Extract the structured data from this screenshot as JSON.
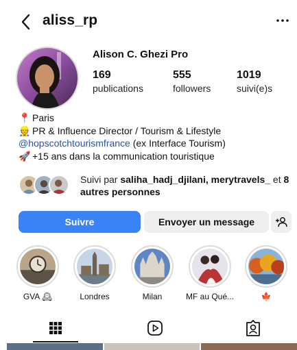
{
  "header": {
    "username": "aliss_rp"
  },
  "profile": {
    "full_name": "Alison C. Ghezi Pro",
    "stats": [
      {
        "value": "169",
        "label": "publications"
      },
      {
        "value": "555",
        "label": "followers"
      },
      {
        "value": "1019",
        "label": "suivi(e)s"
      }
    ]
  },
  "bio": {
    "location": "Paris",
    "role": "PR & Influence Director / Tourism & Lifestyle",
    "link": "@hopscotchtourismfrance",
    "link_suffix": " (ex Interface Tourism)",
    "experience": "+15 ans dans la communication touristique"
  },
  "followed_by": {
    "prefix": "Suivi par ",
    "names": "saliha_hadj_djilani, merytravels_",
    "joiner": " et ",
    "others": "8 autres personnes"
  },
  "buttons": {
    "follow": "Suivre",
    "message": "Envoyer un message"
  },
  "highlights": [
    {
      "label": "GVA 🕰"
    },
    {
      "label": "Londres"
    },
    {
      "label": "Milan"
    },
    {
      "label": "MF au Qué..."
    },
    {
      "label": "🍁"
    }
  ],
  "colors": {
    "primary_button": "#3b82f6",
    "secondary_button": "#efefef",
    "link": "#2a4fa6"
  }
}
